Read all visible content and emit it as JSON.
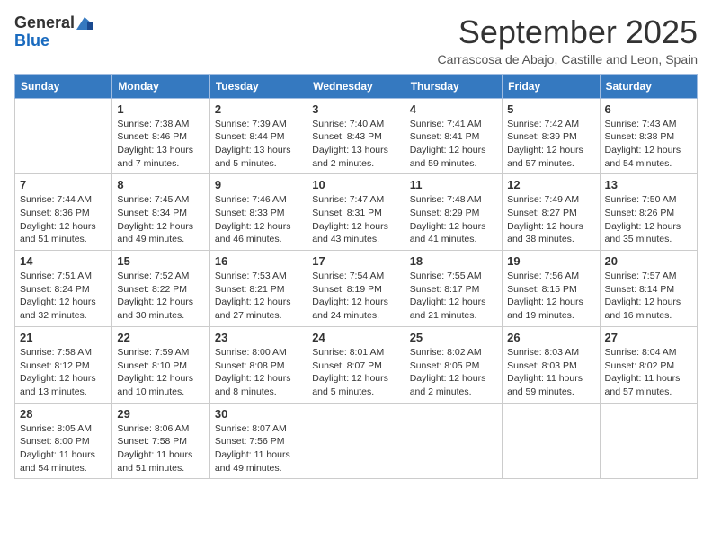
{
  "header": {
    "logo_general": "General",
    "logo_blue": "Blue",
    "title": "September 2025",
    "subtitle": "Carrascosa de Abajo, Castille and Leon, Spain"
  },
  "days_of_week": [
    "Sunday",
    "Monday",
    "Tuesday",
    "Wednesday",
    "Thursday",
    "Friday",
    "Saturday"
  ],
  "weeks": [
    [
      {
        "day": "",
        "info": ""
      },
      {
        "day": "1",
        "info": "Sunrise: 7:38 AM\nSunset: 8:46 PM\nDaylight: 13 hours\nand 7 minutes."
      },
      {
        "day": "2",
        "info": "Sunrise: 7:39 AM\nSunset: 8:44 PM\nDaylight: 13 hours\nand 5 minutes."
      },
      {
        "day": "3",
        "info": "Sunrise: 7:40 AM\nSunset: 8:43 PM\nDaylight: 13 hours\nand 2 minutes."
      },
      {
        "day": "4",
        "info": "Sunrise: 7:41 AM\nSunset: 8:41 PM\nDaylight: 12 hours\nand 59 minutes."
      },
      {
        "day": "5",
        "info": "Sunrise: 7:42 AM\nSunset: 8:39 PM\nDaylight: 12 hours\nand 57 minutes."
      },
      {
        "day": "6",
        "info": "Sunrise: 7:43 AM\nSunset: 8:38 PM\nDaylight: 12 hours\nand 54 minutes."
      }
    ],
    [
      {
        "day": "7",
        "info": "Sunrise: 7:44 AM\nSunset: 8:36 PM\nDaylight: 12 hours\nand 51 minutes."
      },
      {
        "day": "8",
        "info": "Sunrise: 7:45 AM\nSunset: 8:34 PM\nDaylight: 12 hours\nand 49 minutes."
      },
      {
        "day": "9",
        "info": "Sunrise: 7:46 AM\nSunset: 8:33 PM\nDaylight: 12 hours\nand 46 minutes."
      },
      {
        "day": "10",
        "info": "Sunrise: 7:47 AM\nSunset: 8:31 PM\nDaylight: 12 hours\nand 43 minutes."
      },
      {
        "day": "11",
        "info": "Sunrise: 7:48 AM\nSunset: 8:29 PM\nDaylight: 12 hours\nand 41 minutes."
      },
      {
        "day": "12",
        "info": "Sunrise: 7:49 AM\nSunset: 8:27 PM\nDaylight: 12 hours\nand 38 minutes."
      },
      {
        "day": "13",
        "info": "Sunrise: 7:50 AM\nSunset: 8:26 PM\nDaylight: 12 hours\nand 35 minutes."
      }
    ],
    [
      {
        "day": "14",
        "info": "Sunrise: 7:51 AM\nSunset: 8:24 PM\nDaylight: 12 hours\nand 32 minutes."
      },
      {
        "day": "15",
        "info": "Sunrise: 7:52 AM\nSunset: 8:22 PM\nDaylight: 12 hours\nand 30 minutes."
      },
      {
        "day": "16",
        "info": "Sunrise: 7:53 AM\nSunset: 8:21 PM\nDaylight: 12 hours\nand 27 minutes."
      },
      {
        "day": "17",
        "info": "Sunrise: 7:54 AM\nSunset: 8:19 PM\nDaylight: 12 hours\nand 24 minutes."
      },
      {
        "day": "18",
        "info": "Sunrise: 7:55 AM\nSunset: 8:17 PM\nDaylight: 12 hours\nand 21 minutes."
      },
      {
        "day": "19",
        "info": "Sunrise: 7:56 AM\nSunset: 8:15 PM\nDaylight: 12 hours\nand 19 minutes."
      },
      {
        "day": "20",
        "info": "Sunrise: 7:57 AM\nSunset: 8:14 PM\nDaylight: 12 hours\nand 16 minutes."
      }
    ],
    [
      {
        "day": "21",
        "info": "Sunrise: 7:58 AM\nSunset: 8:12 PM\nDaylight: 12 hours\nand 13 minutes."
      },
      {
        "day": "22",
        "info": "Sunrise: 7:59 AM\nSunset: 8:10 PM\nDaylight: 12 hours\nand 10 minutes."
      },
      {
        "day": "23",
        "info": "Sunrise: 8:00 AM\nSunset: 8:08 PM\nDaylight: 12 hours\nand 8 minutes."
      },
      {
        "day": "24",
        "info": "Sunrise: 8:01 AM\nSunset: 8:07 PM\nDaylight: 12 hours\nand 5 minutes."
      },
      {
        "day": "25",
        "info": "Sunrise: 8:02 AM\nSunset: 8:05 PM\nDaylight: 12 hours\nand 2 minutes."
      },
      {
        "day": "26",
        "info": "Sunrise: 8:03 AM\nSunset: 8:03 PM\nDaylight: 11 hours\nand 59 minutes."
      },
      {
        "day": "27",
        "info": "Sunrise: 8:04 AM\nSunset: 8:02 PM\nDaylight: 11 hours\nand 57 minutes."
      }
    ],
    [
      {
        "day": "28",
        "info": "Sunrise: 8:05 AM\nSunset: 8:00 PM\nDaylight: 11 hours\nand 54 minutes."
      },
      {
        "day": "29",
        "info": "Sunrise: 8:06 AM\nSunset: 7:58 PM\nDaylight: 11 hours\nand 51 minutes."
      },
      {
        "day": "30",
        "info": "Sunrise: 8:07 AM\nSunset: 7:56 PM\nDaylight: 11 hours\nand 49 minutes."
      },
      {
        "day": "",
        "info": ""
      },
      {
        "day": "",
        "info": ""
      },
      {
        "day": "",
        "info": ""
      },
      {
        "day": "",
        "info": ""
      }
    ]
  ]
}
